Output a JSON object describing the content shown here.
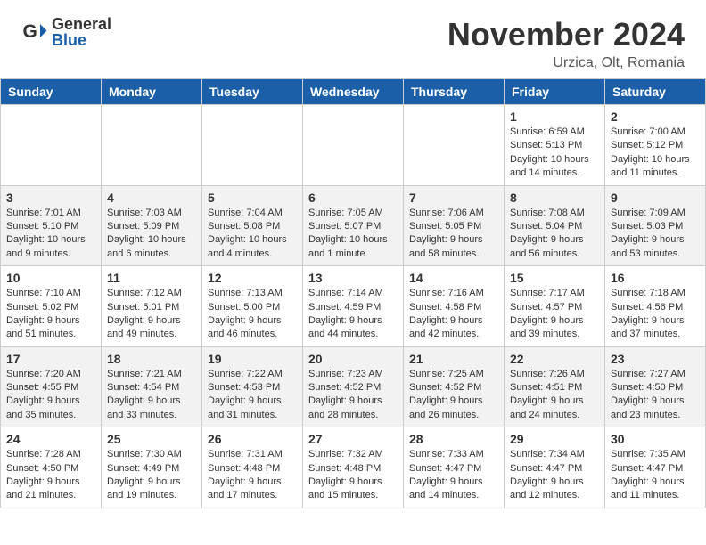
{
  "header": {
    "logo_general": "General",
    "logo_blue": "Blue",
    "month_title": "November 2024",
    "location": "Urzica, Olt, Romania"
  },
  "days_of_week": [
    "Sunday",
    "Monday",
    "Tuesday",
    "Wednesday",
    "Thursday",
    "Friday",
    "Saturday"
  ],
  "weeks": [
    [
      {
        "day": "",
        "detail": ""
      },
      {
        "day": "",
        "detail": ""
      },
      {
        "day": "",
        "detail": ""
      },
      {
        "day": "",
        "detail": ""
      },
      {
        "day": "",
        "detail": ""
      },
      {
        "day": "1",
        "detail": "Sunrise: 6:59 AM\nSunset: 5:13 PM\nDaylight: 10 hours and 14 minutes."
      },
      {
        "day": "2",
        "detail": "Sunrise: 7:00 AM\nSunset: 5:12 PM\nDaylight: 10 hours and 11 minutes."
      }
    ],
    [
      {
        "day": "3",
        "detail": "Sunrise: 7:01 AM\nSunset: 5:10 PM\nDaylight: 10 hours and 9 minutes."
      },
      {
        "day": "4",
        "detail": "Sunrise: 7:03 AM\nSunset: 5:09 PM\nDaylight: 10 hours and 6 minutes."
      },
      {
        "day": "5",
        "detail": "Sunrise: 7:04 AM\nSunset: 5:08 PM\nDaylight: 10 hours and 4 minutes."
      },
      {
        "day": "6",
        "detail": "Sunrise: 7:05 AM\nSunset: 5:07 PM\nDaylight: 10 hours and 1 minute."
      },
      {
        "day": "7",
        "detail": "Sunrise: 7:06 AM\nSunset: 5:05 PM\nDaylight: 9 hours and 58 minutes."
      },
      {
        "day": "8",
        "detail": "Sunrise: 7:08 AM\nSunset: 5:04 PM\nDaylight: 9 hours and 56 minutes."
      },
      {
        "day": "9",
        "detail": "Sunrise: 7:09 AM\nSunset: 5:03 PM\nDaylight: 9 hours and 53 minutes."
      }
    ],
    [
      {
        "day": "10",
        "detail": "Sunrise: 7:10 AM\nSunset: 5:02 PM\nDaylight: 9 hours and 51 minutes."
      },
      {
        "day": "11",
        "detail": "Sunrise: 7:12 AM\nSunset: 5:01 PM\nDaylight: 9 hours and 49 minutes."
      },
      {
        "day": "12",
        "detail": "Sunrise: 7:13 AM\nSunset: 5:00 PM\nDaylight: 9 hours and 46 minutes."
      },
      {
        "day": "13",
        "detail": "Sunrise: 7:14 AM\nSunset: 4:59 PM\nDaylight: 9 hours and 44 minutes."
      },
      {
        "day": "14",
        "detail": "Sunrise: 7:16 AM\nSunset: 4:58 PM\nDaylight: 9 hours and 42 minutes."
      },
      {
        "day": "15",
        "detail": "Sunrise: 7:17 AM\nSunset: 4:57 PM\nDaylight: 9 hours and 39 minutes."
      },
      {
        "day": "16",
        "detail": "Sunrise: 7:18 AM\nSunset: 4:56 PM\nDaylight: 9 hours and 37 minutes."
      }
    ],
    [
      {
        "day": "17",
        "detail": "Sunrise: 7:20 AM\nSunset: 4:55 PM\nDaylight: 9 hours and 35 minutes."
      },
      {
        "day": "18",
        "detail": "Sunrise: 7:21 AM\nSunset: 4:54 PM\nDaylight: 9 hours and 33 minutes."
      },
      {
        "day": "19",
        "detail": "Sunrise: 7:22 AM\nSunset: 4:53 PM\nDaylight: 9 hours and 31 minutes."
      },
      {
        "day": "20",
        "detail": "Sunrise: 7:23 AM\nSunset: 4:52 PM\nDaylight: 9 hours and 28 minutes."
      },
      {
        "day": "21",
        "detail": "Sunrise: 7:25 AM\nSunset: 4:52 PM\nDaylight: 9 hours and 26 minutes."
      },
      {
        "day": "22",
        "detail": "Sunrise: 7:26 AM\nSunset: 4:51 PM\nDaylight: 9 hours and 24 minutes."
      },
      {
        "day": "23",
        "detail": "Sunrise: 7:27 AM\nSunset: 4:50 PM\nDaylight: 9 hours and 23 minutes."
      }
    ],
    [
      {
        "day": "24",
        "detail": "Sunrise: 7:28 AM\nSunset: 4:50 PM\nDaylight: 9 hours and 21 minutes."
      },
      {
        "day": "25",
        "detail": "Sunrise: 7:30 AM\nSunset: 4:49 PM\nDaylight: 9 hours and 19 minutes."
      },
      {
        "day": "26",
        "detail": "Sunrise: 7:31 AM\nSunset: 4:48 PM\nDaylight: 9 hours and 17 minutes."
      },
      {
        "day": "27",
        "detail": "Sunrise: 7:32 AM\nSunset: 4:48 PM\nDaylight: 9 hours and 15 minutes."
      },
      {
        "day": "28",
        "detail": "Sunrise: 7:33 AM\nSunset: 4:47 PM\nDaylight: 9 hours and 14 minutes."
      },
      {
        "day": "29",
        "detail": "Sunrise: 7:34 AM\nSunset: 4:47 PM\nDaylight: 9 hours and 12 minutes."
      },
      {
        "day": "30",
        "detail": "Sunrise: 7:35 AM\nSunset: 4:47 PM\nDaylight: 9 hours and 11 minutes."
      }
    ]
  ]
}
